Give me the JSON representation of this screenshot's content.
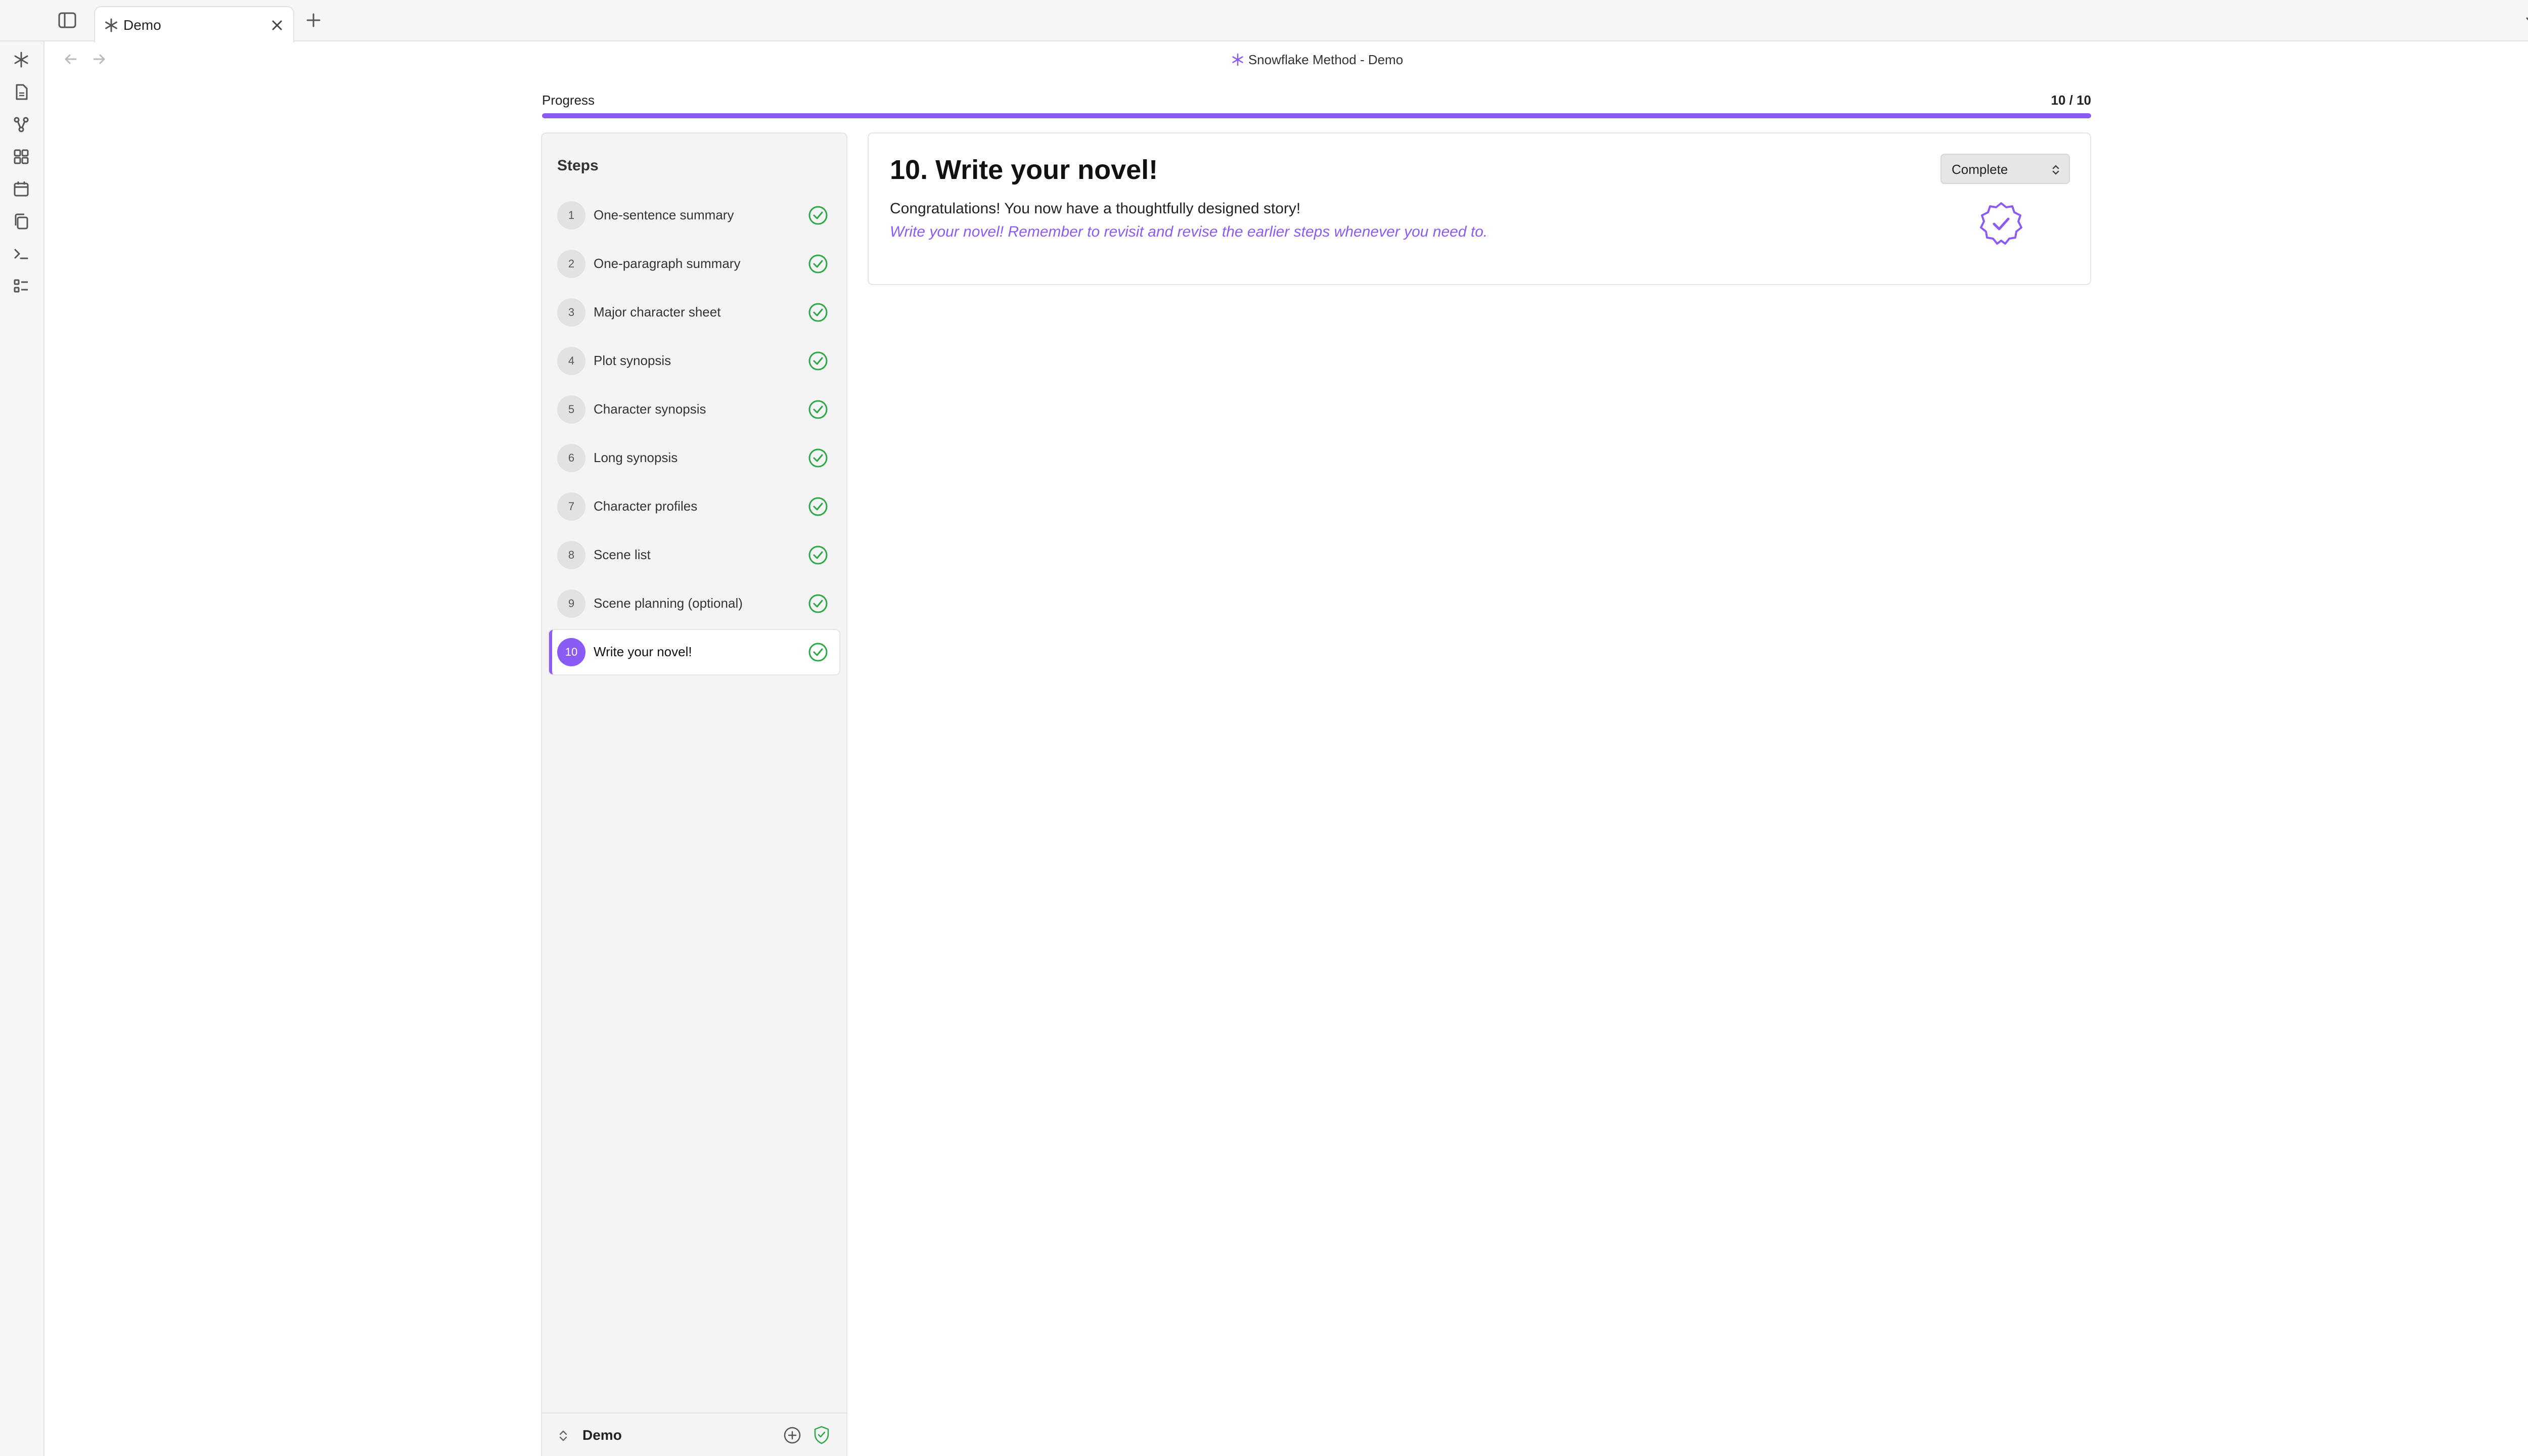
{
  "tab": {
    "label": "Demo",
    "icon": "snowflake-icon"
  },
  "header": {
    "title": "Snowflake Method - Demo"
  },
  "ribbon": {
    "icons": [
      "snowflake-icon",
      "file-icon",
      "graph-icon",
      "dashboard-icon",
      "calendar-icon",
      "copy-icon",
      "terminal-icon",
      "list-icon"
    ]
  },
  "progress": {
    "label": "Progress",
    "count_text": "10 / 10",
    "completed": 10,
    "total": 10
  },
  "steps": {
    "title": "Steps",
    "items": [
      {
        "num": "1",
        "label": "One-sentence summary",
        "done": true
      },
      {
        "num": "2",
        "label": "One-paragraph summary",
        "done": true
      },
      {
        "num": "3",
        "label": "Major character sheet",
        "done": true
      },
      {
        "num": "4",
        "label": "Plot synopsis",
        "done": true
      },
      {
        "num": "5",
        "label": "Character synopsis",
        "done": true
      },
      {
        "num": "6",
        "label": "Long synopsis",
        "done": true
      },
      {
        "num": "7",
        "label": "Character profiles",
        "done": true
      },
      {
        "num": "8",
        "label": "Scene list",
        "done": true
      },
      {
        "num": "9",
        "label": "Scene planning (optional)",
        "done": true
      },
      {
        "num": "10",
        "label": "Write your novel!",
        "done": true,
        "active": true
      }
    ]
  },
  "footer": {
    "vault_name": "Demo"
  },
  "card": {
    "title": "10. Write your novel!",
    "text": "Congratulations! You now have a thoughtfully designed story!",
    "hint": "Write your novel! Remember to revisit and revise the earlier steps whenever you need to.",
    "status": "Complete"
  },
  "colors": {
    "accent": "#8a5cf5",
    "check": "#2aa84a"
  }
}
